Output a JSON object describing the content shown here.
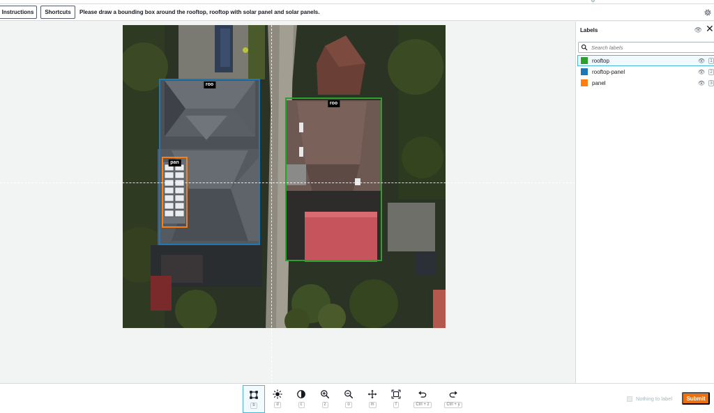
{
  "header": {
    "instructions_label": "Instructions",
    "shortcuts_label": "Shortcuts",
    "task_text": "Please draw a bounding box around the rooftop, rooftop with solar panel and solar panels.",
    "settings_icon": "gear-icon"
  },
  "canvas": {
    "boxes": [
      {
        "tag": "roo",
        "label": "rooftop-panel",
        "color": "#1f77b4"
      },
      {
        "tag": "roo",
        "label": "rooftop",
        "color": "#2ca02c"
      },
      {
        "tag": "pan",
        "label": "panel",
        "color": "#ff7f0e"
      }
    ]
  },
  "sidebar": {
    "title": "Labels",
    "search_placeholder": "Search labels",
    "labels": [
      {
        "name": "rooftop",
        "color": "#2ca02c",
        "key": "1"
      },
      {
        "name": "rooftop-panel",
        "color": "#1f77b4",
        "key": "2"
      },
      {
        "name": "panel",
        "color": "#ff7f0e",
        "key": "3"
      }
    ]
  },
  "toolbar": {
    "tools": [
      {
        "icon": "bounding-box-icon",
        "key": "b"
      },
      {
        "icon": "brightness-icon",
        "key": "d"
      },
      {
        "icon": "contrast-icon",
        "key": "c"
      },
      {
        "icon": "zoom-in-icon",
        "key": "z"
      },
      {
        "icon": "zoom-out-icon",
        "key": "o"
      },
      {
        "icon": "move-icon",
        "key": "m"
      },
      {
        "icon": "fit-screen-icon",
        "key": "f"
      },
      {
        "icon": "undo-icon",
        "key": "Ctrl + z"
      },
      {
        "icon": "redo-icon",
        "key": "Ctrl + y"
      }
    ],
    "nothing_to_label": "Nothing to label",
    "submit_label": "Submit"
  },
  "colors": {
    "accent": "#ec7211",
    "selection": "#44b9d6"
  }
}
